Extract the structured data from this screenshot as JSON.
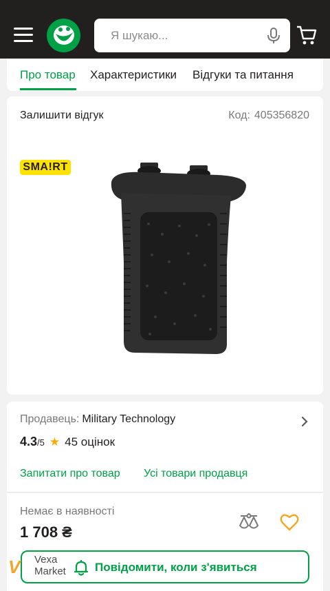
{
  "header": {
    "search_placeholder": "Я шукаю..."
  },
  "tabs": [
    {
      "label": "Про товар"
    },
    {
      "label": "Характеристики"
    },
    {
      "label": "Відгуки та питання"
    }
  ],
  "product": {
    "leave_review": "Залишити відгук",
    "code_label": "Код:",
    "code_value": "405356820",
    "badge": "SMA!RT"
  },
  "seller": {
    "label": "Продавець:",
    "name": "Military Technology",
    "rating": "4.3",
    "rating_max": "/5",
    "reviews": "45 оцінок",
    "ask_link": "Запитати про товар",
    "all_products_link": "Усі товари продавця"
  },
  "purchase": {
    "stock_status": "Немає в наявності",
    "price": "1 708 ₴",
    "notify_label": "Повідомити, коли з'явиться"
  },
  "watermark": {
    "mark": "V",
    "line1": "Vexa",
    "line2": "Market"
  },
  "colors": {
    "brand_green": "#00a046",
    "header_dark": "#221f1f",
    "star": "#ffa900",
    "smart_yellow": "#ffe200"
  }
}
